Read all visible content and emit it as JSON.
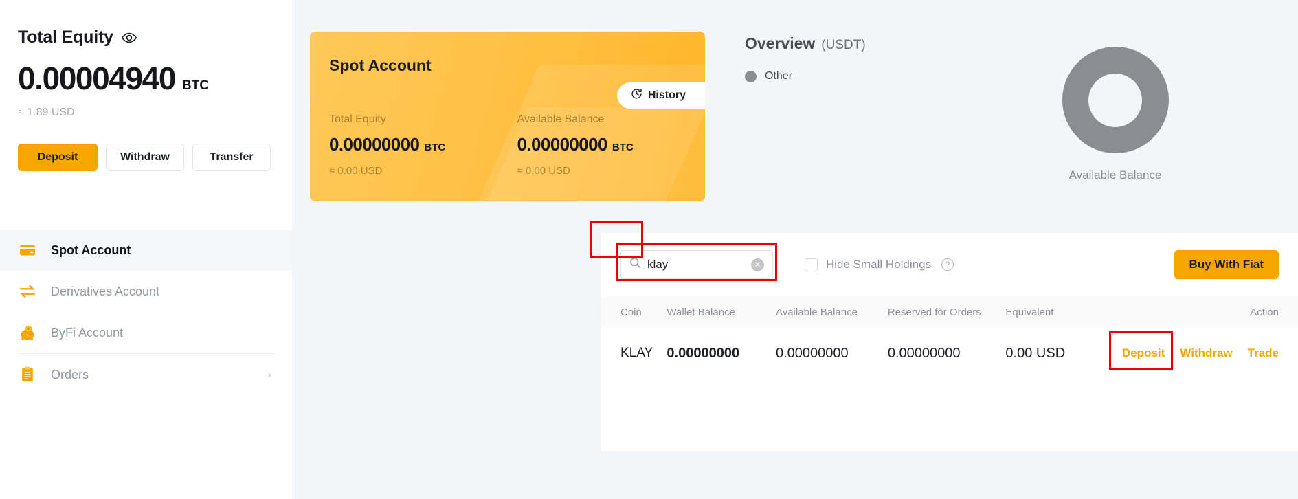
{
  "sidebar": {
    "equity": {
      "title": "Total Equity",
      "eye_icon": "eye-icon",
      "amount": "0.00004940",
      "unit": "BTC",
      "usd_approx": "≈ 1.89 USD",
      "buttons": {
        "deposit": "Deposit",
        "withdraw": "Withdraw",
        "transfer": "Transfer"
      }
    },
    "nav_items": [
      {
        "label": "Spot Account",
        "icon": "card-icon",
        "active": true,
        "chevron": ""
      },
      {
        "label": "Derivatives Account",
        "icon": "swap-arrows-icon",
        "active": false,
        "chevron": ""
      },
      {
        "label": "ByFi Account",
        "icon": "piggy-bank-icon",
        "active": false,
        "chevron": ""
      },
      {
        "label": "Orders",
        "icon": "clipboard-icon",
        "active": false,
        "chevron": "›"
      }
    ]
  },
  "spot_card": {
    "title": "Spot Account",
    "history_label": "History",
    "history_icon": "clock-icon",
    "stats": [
      {
        "label": "Total Equity",
        "value": "0.00000000",
        "unit": "BTC",
        "usd_approx": "≈ 0.00 USD"
      },
      {
        "label": "Available Balance",
        "value": "0.00000000",
        "unit": "BTC",
        "usd_approx": "≈ 0.00 USD"
      }
    ]
  },
  "overview": {
    "title": "Overview",
    "currency": "(USDT)",
    "legend": [
      {
        "label": "Other",
        "color": "#8b8d93"
      }
    ],
    "donut_label": "Available Balance"
  },
  "chart_data": {
    "type": "pie",
    "title": "Overview (USDT)",
    "categories": [
      "Other"
    ],
    "values": [
      100
    ],
    "colors": [
      "#8b8d93"
    ],
    "legend_position": "left",
    "annotation": "Available Balance",
    "hole": 0.5
  },
  "filters": {
    "search": {
      "value": "klay",
      "placeholder": "Search",
      "search_icon": "search-icon",
      "clear_icon": "clear-circle-icon"
    },
    "hide_small_holdings": {
      "label": "Hide Small Holdings",
      "checked": false,
      "help_icon": "question-mark-icon"
    },
    "buy_with_fiat": "Buy With Fiat"
  },
  "table": {
    "columns": [
      "Coin",
      "Wallet Balance",
      "Available Balance",
      "Reserved for Orders",
      "Equivalent",
      "Action"
    ],
    "rows": [
      {
        "coin": "KLAY",
        "wallet_balance": "0.00000000",
        "available_balance": "0.00000000",
        "reserved_for_orders": "0.00000000",
        "equivalent": "0.00 USD",
        "actions": [
          "Deposit",
          "Withdraw",
          "Trade"
        ]
      }
    ]
  },
  "annotations": {
    "color": "#ee0000",
    "targets": [
      "search-input",
      "coin-name-klay",
      "deposit-link"
    ]
  },
  "theme": {
    "accent": "#f7a600",
    "card_gradient_start": "#ffc859",
    "card_gradient_end": "#ffb528",
    "donut_gray": "#8b8d93"
  }
}
